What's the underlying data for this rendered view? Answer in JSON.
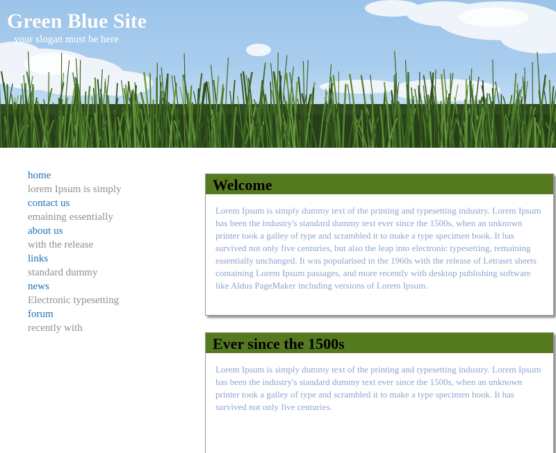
{
  "header": {
    "title": "Green Blue Site",
    "slogan": "your slogan must be here"
  },
  "sidebar": {
    "items": [
      {
        "label": "home",
        "desc": "lorem Ipsum is simply"
      },
      {
        "label": "contact us",
        "desc": "emaining essentially"
      },
      {
        "label": "about us",
        "desc": "with the release"
      },
      {
        "label": "links",
        "desc": "standard dummy"
      },
      {
        "label": "news",
        "desc": "Electronic typesetting"
      },
      {
        "label": "forum",
        "desc": "recently with"
      }
    ]
  },
  "main": {
    "sections": [
      {
        "heading": "Welcome",
        "text": "Lorem Ipsum is simply dummy text of the printing and typesetting industry. Lorem Ipsum has been the industry's standard dummy text ever since the 1500s, when an unknown printer took a galley of type and scrambled it to make a type specimen book. It has survived not only five centuries, but also the leap into electronic typesetting, remaining essentially unchanged. It was popularised in the 1960s with the release of Letraset sheets containing Lorem Ipsum passages, and more recently with desktop publishing software like Aldus PageMaker including versions of Lorem Ipsum."
      },
      {
        "heading": "Ever since the 1500s",
        "text": "Lorem Ipsum is simply dummy text of the printing and typesetting industry. Lorem Ipsum has been the industry's standard dummy text ever since the 1500s, when an unknown printer took a galley of type and scrambled it to make a type specimen book. It has survived not only five centuries."
      }
    ]
  },
  "colors": {
    "link": "#1f6fb8",
    "muted_text": "#8f8f8f",
    "section_header_bg": "#55791f",
    "body_text": "#8fa4cf"
  }
}
